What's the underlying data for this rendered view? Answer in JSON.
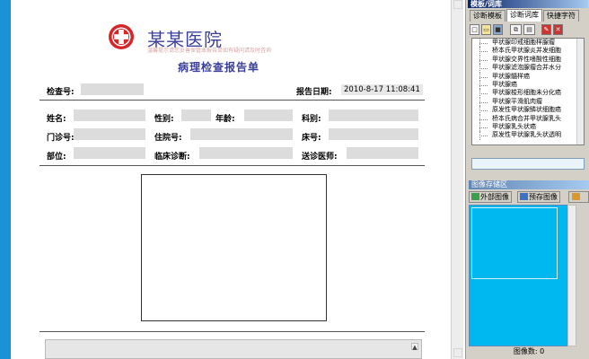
{
  "header": {
    "hospital_name": "某某医院",
    "hospital_subtitle": "温馨提示请您妥善保管本报告单如有疑问请及时咨询",
    "report_title": "病理检查报告单"
  },
  "form": {
    "exam_no_label": "检查号:",
    "exam_no_value": "",
    "report_date_label": "报告日期:",
    "report_date_value": "2010-8-17 11:08:41",
    "name_label": "姓名:",
    "sex_label": "性别:",
    "age_label": "年龄:",
    "dept_label": "科别:",
    "outpatient_label": "门诊号:",
    "inpatient_label": "住院号:",
    "bed_label": "床号:",
    "site_label": "部位:",
    "clinical_label": "临床诊断:",
    "doctor_label": "送诊医师:"
  },
  "panel": {
    "title": "模板/词库",
    "tabs": [
      "诊断模板",
      "诊断词库",
      "快捷字符"
    ],
    "active_tab": 1,
    "toolbar_icons": [
      "new-doc-icon",
      "open-folder-icon",
      "save-icon",
      "copy-icon",
      "paste-icon",
      "edit-icon",
      "delete-icon"
    ],
    "terms": [
      "甲状腺印戒细胞样腺瘤",
      "桥本氏甲状腺炎并发细胞",
      "甲状腺交界性嗜酸性细胞",
      "甲状腺滤泡腺瘤合并水分",
      "甲状腺髓样癌",
      "甲状腺癌",
      "甲状腺梭形细胞未分化癌",
      "甲状腺平滑肌肉瘤",
      "原发性甲状腺鳞状细胞癌",
      "桥本氏病合并甲状腺乳头",
      "甲状腺乳头状癌",
      "原发性甲状腺乳头状透明"
    ]
  },
  "image_area": {
    "title": "图像存储区",
    "external_btn": "外部图像",
    "stored_btn": "预存图像",
    "count_label": "图像数:",
    "count_value": "0"
  },
  "colors": {
    "accent_blue": "#1793d6",
    "title_navy": "#3a3f9c",
    "logo_red": "#d6262a",
    "image_store_bg": "#00b8f0"
  }
}
